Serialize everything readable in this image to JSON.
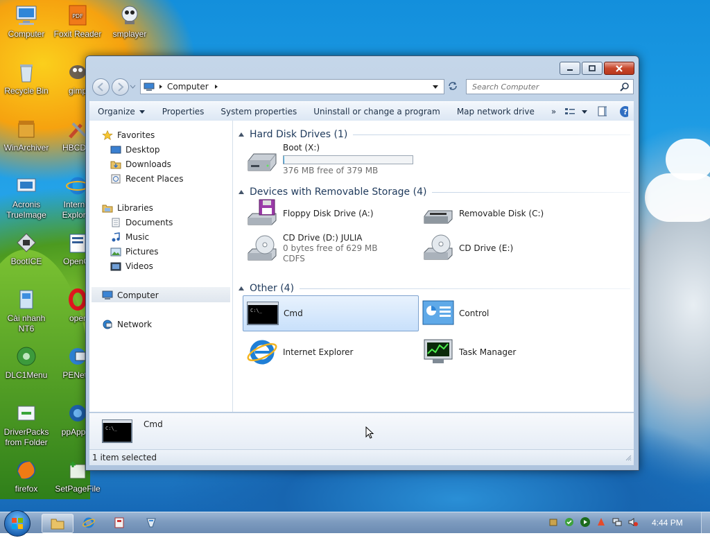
{
  "desktop": {
    "icons": [
      {
        "label": "Computer",
        "icon": "computer-icon"
      },
      {
        "label": "Foxit Reader",
        "icon": "pdf-icon"
      },
      {
        "label": "smplayer",
        "icon": "smplayer-icon"
      },
      {
        "label": "Recycle Bin",
        "icon": "recycle-bin-icon"
      },
      {
        "label": "gimp",
        "icon": "gimp-icon"
      },
      {
        "label": "WinArchiver",
        "icon": "archive-icon"
      },
      {
        "label": "HBCDM",
        "icon": "tools-icon"
      },
      {
        "label": "Acronis TrueImage",
        "icon": "acronis-icon"
      },
      {
        "label": "Internet Explorer",
        "icon": "internet-explorer-icon"
      },
      {
        "label": "BootICE",
        "icon": "bootice-icon"
      },
      {
        "label": "OpenOf",
        "icon": "openoffice-icon"
      },
      {
        "label": "Cài nhanh NT6",
        "icon": "setup-icon"
      },
      {
        "label": "oper",
        "icon": "opera-icon"
      },
      {
        "label": "DLC1Menu",
        "icon": "dlc-icon"
      },
      {
        "label": "PENetw",
        "icon": "network-icon"
      },
      {
        "label": "DriverPacks from Folder",
        "icon": "driverpacks-icon"
      },
      {
        "label": "ppAppsv",
        "icon": "ppapps-icon"
      },
      {
        "label": "firefox",
        "icon": "firefox-icon"
      },
      {
        "label": "SetPageFile",
        "icon": "setpagefile-icon"
      }
    ]
  },
  "window": {
    "address": {
      "root_label": "Computer"
    },
    "search": {
      "placeholder": "Search Computer"
    },
    "command_bar": [
      {
        "label": "Organize",
        "dropdown": true
      },
      {
        "label": "Properties"
      },
      {
        "label": "System properties"
      },
      {
        "label": "Uninstall or change a program"
      },
      {
        "label": "Map network drive"
      },
      {
        "label": "»"
      }
    ],
    "nav_pane": {
      "favorites": {
        "label": "Favorites",
        "items": [
          "Desktop",
          "Downloads",
          "Recent Places"
        ]
      },
      "libraries": {
        "label": "Libraries",
        "items": [
          "Documents",
          "Music",
          "Pictures",
          "Videos"
        ]
      },
      "computer": "Computer",
      "network": "Network"
    },
    "groups": {
      "hdd": {
        "title": "Hard Disk Drives (1)",
        "items": [
          {
            "name": "Boot (X:)",
            "space": "376 MB free of 379 MB",
            "used_fraction": 0.008
          }
        ]
      },
      "removable": {
        "title": "Devices with Removable Storage (4)",
        "items": [
          {
            "name": "Floppy Disk Drive (A:)"
          },
          {
            "name": "Removable Disk (C:)"
          },
          {
            "name": "CD Drive (D:) JULIA",
            "space": "0 bytes free of 629 MB",
            "fs": "CDFS"
          },
          {
            "name": "CD Drive (E:)"
          }
        ]
      },
      "other": {
        "title": "Other (4)",
        "items": [
          {
            "name": "Cmd",
            "selected": true
          },
          {
            "name": "Control"
          },
          {
            "name": "Internet Explorer"
          },
          {
            "name": "Task Manager"
          }
        ]
      }
    },
    "details": {
      "name": "Cmd"
    },
    "status": "1 item selected"
  },
  "taskbar": {
    "clock": "4:44 PM",
    "pinned": [
      "explorer-icon",
      "internet-explorer-icon",
      "app-icon",
      "pin-icon"
    ]
  }
}
